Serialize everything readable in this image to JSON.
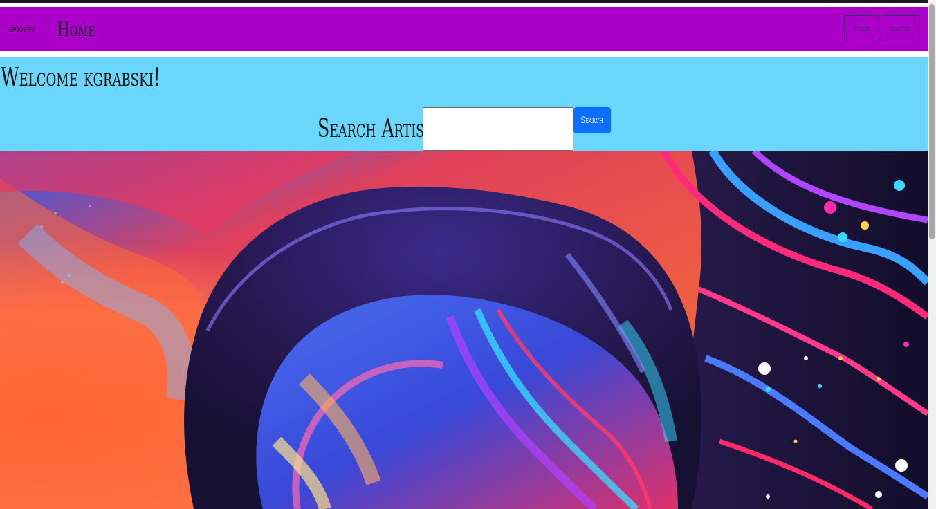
{
  "navbar": {
    "brand": "spoofify",
    "home_label": "Home",
    "login_label": "login",
    "logout_label": "logout",
    "background": "#aa00c8"
  },
  "welcome": {
    "text": "Welcome kgrabski!"
  },
  "search": {
    "label": "Search Artist:",
    "value": "",
    "placeholder": "",
    "button_label": "Search",
    "button_color": "#0d6efd"
  },
  "band": {
    "background": "#6bd6fc"
  },
  "hero": {
    "icon": "psychedelic-artwork-image"
  }
}
